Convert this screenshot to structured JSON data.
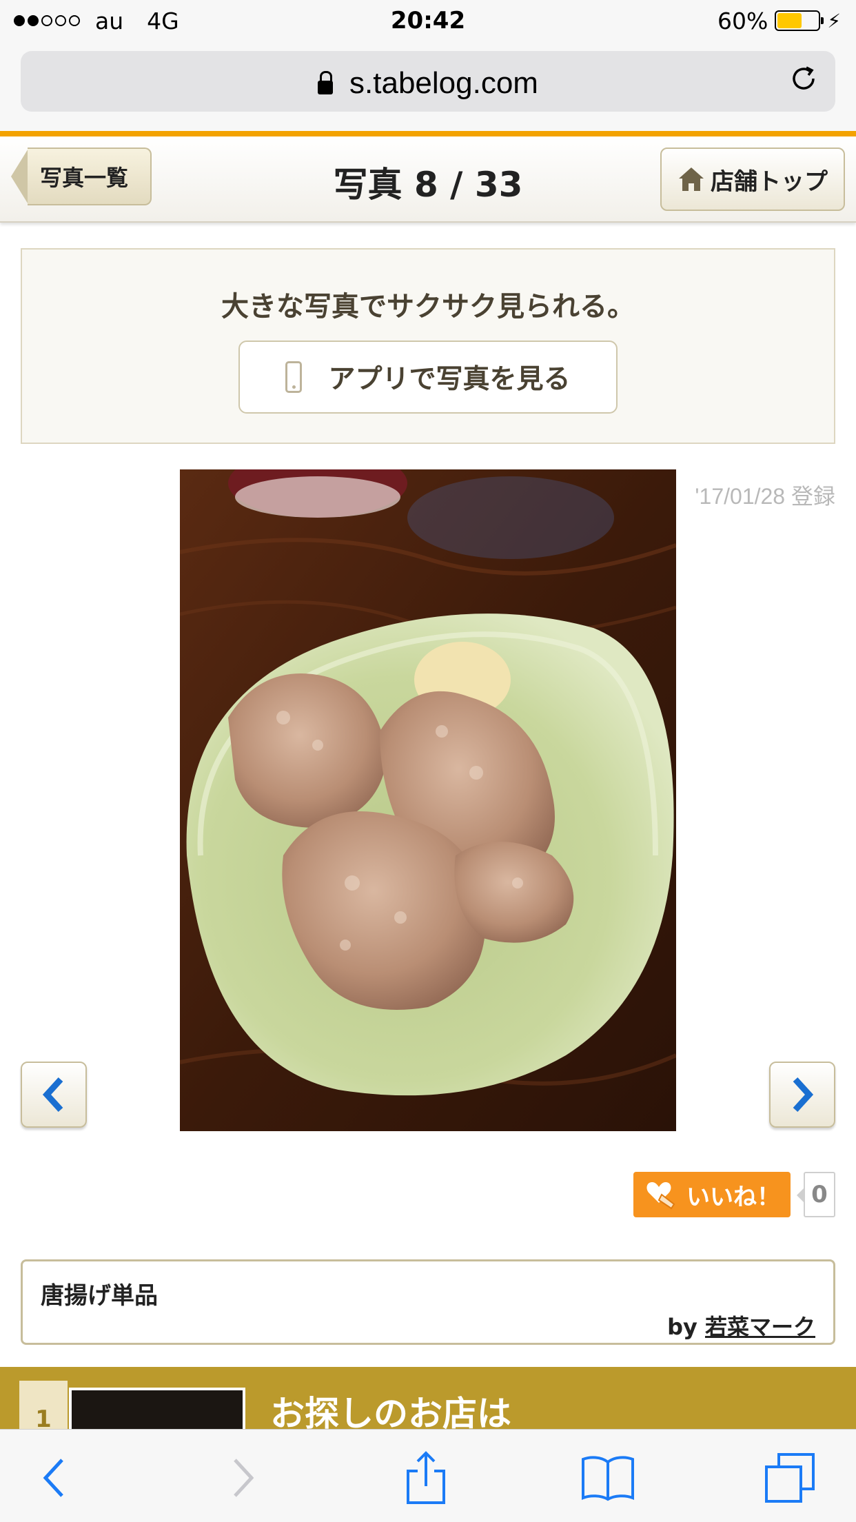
{
  "status_bar": {
    "carrier": "au",
    "network": "4G",
    "time": "20:42",
    "battery": "60%",
    "battery_level": 0.6,
    "signal_bars_filled": 2,
    "signal_bars_total": 5
  },
  "browser": {
    "url": "s.tabelog.com"
  },
  "header": {
    "back_label": "写真一覧",
    "title": "写真 8 / 33",
    "store_top_label": "店舗トップ"
  },
  "promo": {
    "text": "大きな写真でサクサク見られる。",
    "button_label": "アプリで写真を見る"
  },
  "photo": {
    "date": "'17/01/28 登録"
  },
  "like": {
    "label": "いいね！",
    "count": "0"
  },
  "caption": {
    "title": "唐揚げ単品",
    "by": "by",
    "user": "若菜マーク"
  },
  "banner": {
    "rank": "1",
    "text": "お探しのお店は"
  },
  "colors": {
    "accent_orange": "#f3a200",
    "like_orange": "#f7931e",
    "banner_gold": "#bb9a2c",
    "nav_blue": "#1a6fd1",
    "ios_blue": "#1b7bf6"
  },
  "icons": {
    "lock": "lock-icon",
    "reload": "reload-icon",
    "home": "home-icon",
    "phone": "smartphone-icon",
    "prev": "chevron-left-icon",
    "next": "chevron-right-icon",
    "like": "heart-hand-icon",
    "toolbar": [
      "back-icon",
      "forward-icon",
      "share-icon",
      "bookmarks-icon",
      "tabs-icon"
    ]
  }
}
